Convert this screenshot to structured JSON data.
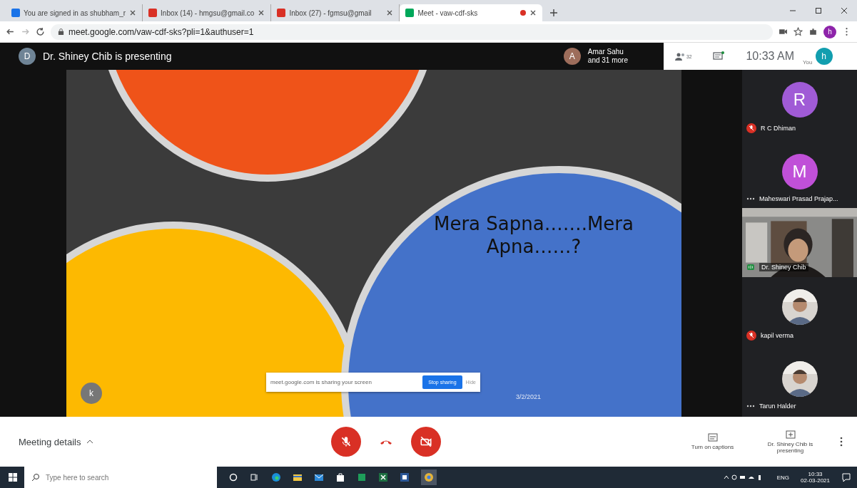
{
  "browser": {
    "tabs": [
      {
        "title": "You are signed in as shubham_r",
        "color": "#1a73e8",
        "selected": false,
        "recording": false
      },
      {
        "title": "Inbox (14) - hmgsu@gmail.co",
        "color": "#d93025",
        "selected": false,
        "recording": false
      },
      {
        "title": "Inbox (27) - fgmsu@gmail",
        "color": "#d93025",
        "selected": false,
        "recording": false
      },
      {
        "title": "Meet - vaw-cdf-sks",
        "color": "#00a85a",
        "selected": true,
        "recording": true
      }
    ],
    "url": "meet.google.com/vaw-cdf-sks?pli=1&authuser=1",
    "profile_initial": "h"
  },
  "top_bar": {
    "presenter_initial": "D",
    "presenter_text": "Dr. Shiney Chib is presenting",
    "others_initial": "A",
    "others_name": "Amar Sahu",
    "others_more": "and 31 more",
    "people_count": "32",
    "time": "10:33 AM",
    "you_label": "You",
    "you_initial": "h"
  },
  "slide": {
    "title": "Mera Sapna…….Mera Apna……?",
    "date": "3/2/2021",
    "self_initial": "k"
  },
  "share_bar": {
    "message": "meet.google.com is sharing your screen",
    "stop": "Stop sharing",
    "hide": "Hide"
  },
  "participants": [
    {
      "kind": "avatar",
      "initial": "R",
      "color": "#a05bd6",
      "name": "R C Dhiman",
      "muted": true,
      "speaking": false
    },
    {
      "kind": "avatar",
      "initial": "M",
      "color": "#c050d8",
      "name": "Maheswari Prasad Prajap...",
      "muted": false,
      "speaking": false
    },
    {
      "kind": "video",
      "name": "Dr. Shiney Chib",
      "muted": false,
      "speaking": true
    },
    {
      "name": "kapil verma",
      "muted": true,
      "speaking": false
    },
    {
      "name": "Tarun Halder",
      "muted": false,
      "speaking": false
    }
  ],
  "bottom_bar": {
    "details": "Meeting details",
    "mic_on": false,
    "camera_on": false,
    "captions": "Turn on captions",
    "presenting": "Dr. Shiney Chib is presenting"
  },
  "taskbar": {
    "search_placeholder": "Type here to search",
    "lang": "ENG",
    "time": "10:33",
    "date": "02-03-2021"
  }
}
